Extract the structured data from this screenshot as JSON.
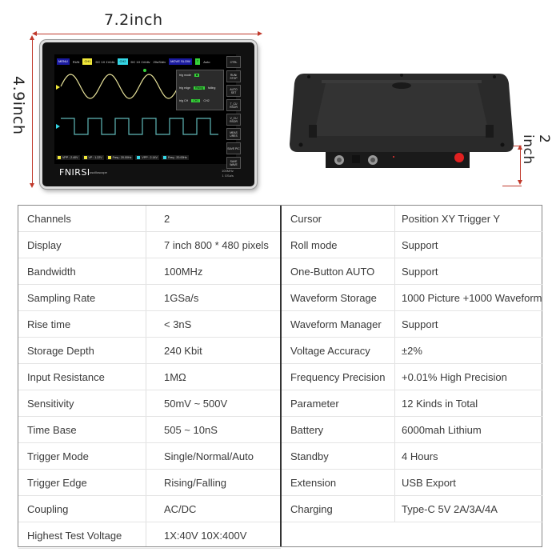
{
  "dimensions": {
    "width_label": "7.2inch",
    "height_label": "4.9inch",
    "depth_label": "2 inch",
    "accent_color": "#c0392b"
  },
  "device_screen": {
    "menu_label": "MENU",
    "run_label": "RUN",
    "ch1_label": "CH1",
    "ch1_info": "DC 1X 1V/div",
    "ch2_label": "CH2",
    "ch2_info": "DC 1X 1V/div",
    "timebase": "20uS/div",
    "move_label": "MOVE SLOW",
    "trigger_label": "T",
    "trigger_mode_auto": "Auto",
    "trigger_channel": "CH1",
    "trig_panel": {
      "mode_label": "trig mode",
      "edge_label": "trig edge",
      "edge_rising": "Rising",
      "edge_falling": "falling",
      "ch_label": "trig CH",
      "ch1": "CH1",
      "ch2": "CH2"
    },
    "side_buttons": [
      "CTRL",
      "RUN/ STOP",
      "AUTO SET",
      "T_CU RSOR",
      "V_CU RSOR",
      "MEAS URES",
      "SAVE PIC",
      "SAVE WAVE"
    ],
    "measurements": [
      {
        "ch": "1",
        "text": "VPP : 2.40V"
      },
      {
        "ch": "1",
        "text": "VP : 1.22V"
      },
      {
        "ch": "1",
        "text": "Freq : 20.00Hz"
      },
      {
        "ch": "2",
        "text": "VPP : 2.14V"
      },
      {
        "ch": "2",
        "text": "Freq : 20.00Hz"
      }
    ],
    "ch1_color": "#f2e93a",
    "ch2_color": "#35d7e6",
    "brand": "FNIRSI",
    "brand_sub": "oscilloscope",
    "corner_spec_1": "100MHz",
    "corner_spec_2": "1 GSa/s"
  },
  "specs_left": [
    {
      "key": "Channels",
      "value": "2"
    },
    {
      "key": "Display",
      "value": "7 inch 800 * 480 pixels"
    },
    {
      "key": "Bandwidth",
      "value": "100MHz"
    },
    {
      "key": "Sampling Rate",
      "value": "1GSa/s"
    },
    {
      "key": "Rise time",
      "value": "< 3nS"
    },
    {
      "key": "Storage Depth",
      "value": "240 Kbit"
    },
    {
      "key": "Input Resistance",
      "value": "1MΩ"
    },
    {
      "key": "Sensitivity",
      "value": "50mV ~ 500V"
    },
    {
      "key": "Time Base",
      "value": "505 ~ 10nS"
    },
    {
      "key": "Trigger Mode",
      "value": "Single/Normal/Auto"
    },
    {
      "key": "Trigger Edge",
      "value": "Rising/Falling"
    },
    {
      "key": "Coupling",
      "value": "AC/DC"
    },
    {
      "key": "Highest Test Voltage",
      "value": "1X:40V 10X:400V"
    }
  ],
  "specs_right": [
    {
      "key": "Cursor",
      "value": "Position XY Trigger Y"
    },
    {
      "key": "Roll mode",
      "value": "Support"
    },
    {
      "key": "One-Button AUTO",
      "value": "Support"
    },
    {
      "key": "Waveform Storage",
      "value": "1000 Picture +1000 Waveform"
    },
    {
      "key": "Waveform Manager",
      "value": "Support"
    },
    {
      "key": "Voltage Accuracy",
      "value": "±2%"
    },
    {
      "key": "Frequency Precision",
      "value": "+0.01% High Precision"
    },
    {
      "key": "Parameter",
      "value": "12 Kinds in Total"
    },
    {
      "key": "Battery",
      "value": "6000mah Lithium"
    },
    {
      "key": "Standby",
      "value": "4 Hours"
    },
    {
      "key": "Extension",
      "value": "USB Export"
    },
    {
      "key": "Charging",
      "value": "Type-C 5V 2A/3A/4A"
    }
  ]
}
